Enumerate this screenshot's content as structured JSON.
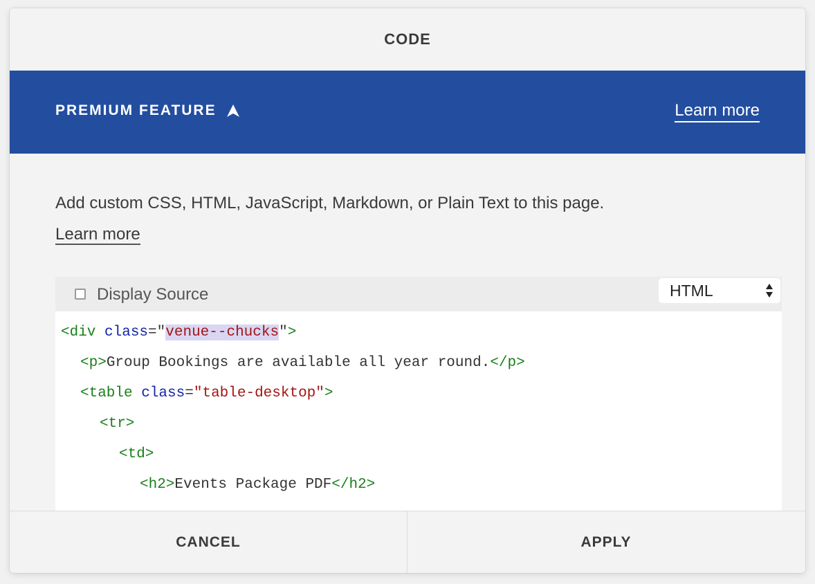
{
  "header": {
    "title": "CODE"
  },
  "premium": {
    "label": "PREMIUM FEATURE",
    "icon": "premium-chevron-icon",
    "learn_more": "Learn more",
    "color": "#234ea0"
  },
  "description": {
    "text": "Add custom CSS, HTML, JavaScript, Markdown, or Plain Text to this page.",
    "learn_more": "Learn more"
  },
  "editor": {
    "display_source_label": "Display Source",
    "display_source_checked": false,
    "language": "HTML",
    "code": {
      "line1": {
        "open": "<div",
        "attr": " class",
        "eq": "=\"",
        "value": "venue--chucks",
        "close_q": "\"",
        "close": ">"
      },
      "line2": {
        "open": "<p>",
        "text": "Group Bookings are available all year round.",
        "close": "</p>"
      },
      "line3": {
        "open": "<table",
        "attr": " class",
        "eq": "=",
        "value": "\"table-desktop\"",
        "close": ">"
      },
      "line4": {
        "tag": "<tr>"
      },
      "line5": {
        "tag": "<td>"
      },
      "line6": {
        "open": "<h2>",
        "text": "Events Package PDF",
        "close": "</h2>"
      }
    }
  },
  "footer": {
    "cancel": "CANCEL",
    "apply": "APPLY"
  }
}
